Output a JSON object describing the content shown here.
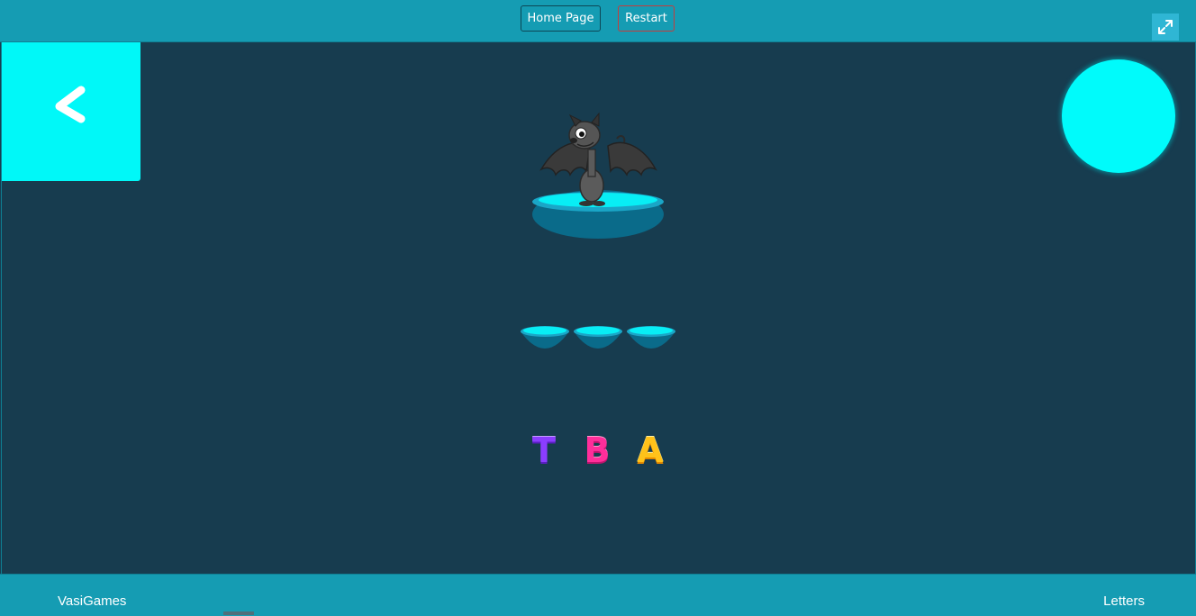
{
  "header": {
    "home_label": "Home Page",
    "restart_label": "Restart"
  },
  "game": {
    "back_icon": "chevron-left-icon",
    "sound_button_color": "#00fbfb",
    "picture": "bat",
    "answer_slots": 3,
    "letters": [
      "T",
      "B",
      "A"
    ],
    "letter_colors": [
      "#8b3dff",
      "#ff2e9a",
      "#ffc21a"
    ]
  },
  "footer": {
    "brand": "VasiGames",
    "category": "Letters",
    "fullscreen_icon": "expand-icon"
  },
  "colors": {
    "bar": "#159cb3",
    "background": "#173c4f",
    "accent": "#00f8f8"
  }
}
